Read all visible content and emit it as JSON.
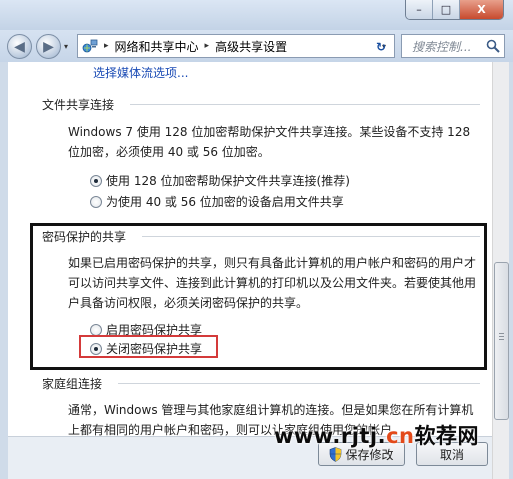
{
  "window": {
    "minimize_glyph": "–",
    "maximize_glyph": "□",
    "close_glyph": "X"
  },
  "nav": {
    "back_glyph": "◀",
    "forward_glyph": "▶",
    "recent_glyph": "▾",
    "breadcrumb": [
      "网络和共享中心",
      "高级共享设置"
    ],
    "separator": "▸",
    "dropdown_glyph": "▾",
    "refresh_glyph": "↻",
    "search_placeholder": "搜索控制..."
  },
  "content": {
    "top_link": "选择媒体流选项...",
    "file_sharing": {
      "heading": "文件共享连接",
      "description": "Windows 7 使用 128 位加密帮助保护文件共享连接。某些设备不支持 128 位加密，必须使用 40 或 56 位加密。",
      "options": [
        {
          "label": "使用 128 位加密帮助保护文件共享连接(推荐)",
          "selected": true
        },
        {
          "label": "为使用 40 或 56 位加密的设备启用文件共享",
          "selected": false
        }
      ]
    },
    "password_sharing": {
      "heading": "密码保护的共享",
      "description": "如果已启用密码保护的共享，则只有具备此计算机的用户帐户和密码的用户才可以访问共享文件、连接到此计算机的打印机以及公用文件夹。若要使其他用户具备访问权限，必须关闭密码保护的共享。",
      "options": [
        {
          "label": "启用密码保护共享",
          "selected": false
        },
        {
          "label": "关闭密码保护共享",
          "selected": true
        }
      ]
    },
    "homegroup": {
      "heading": "家庭组连接",
      "description": "通常，Windows 管理与其他家庭组计算机的连接。但是如果您在所有计算机上都有相同的用户帐户和密码，则可以让家庭组使用您的帐户。"
    }
  },
  "buttons": {
    "save": "保存修改",
    "cancel": "取消"
  },
  "watermark": {
    "part1": "www.rjtj.",
    "part2": "cn",
    "part3": "软荐网"
  },
  "colors": {
    "link": "#1a4bb5",
    "highlight_box": "#111111",
    "selected_box": "#d43a3a",
    "watermark_accent": "#e34a1a"
  }
}
